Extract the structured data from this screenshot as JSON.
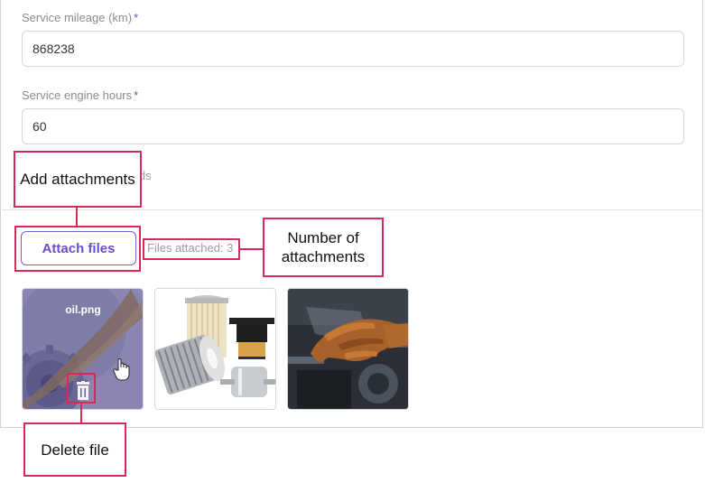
{
  "form": {
    "mileage_label": "Service mileage (km)",
    "required_mark": "*",
    "mileage_value": "868238",
    "engine_hours_label": "Service engine hours",
    "engine_hours_value": "60",
    "partially_hidden_text": "lds"
  },
  "attachments": {
    "attach_button_label": "Attach files",
    "files_attached_text": "Files attached: 3",
    "files": [
      {
        "name": "oil.png",
        "state": "hovered",
        "delete_icon": "trash-icon"
      },
      {
        "name": "",
        "state": "default"
      },
      {
        "name": "",
        "state": "default"
      }
    ]
  },
  "callouts": {
    "add_attachments": "Add attachments",
    "number_of_attachments": "Number of attachments",
    "delete_file": "Delete file"
  },
  "colors": {
    "accent": "#6c4fd1",
    "callout_border": "#d82a5a",
    "hover_overlay": "#5a4f8c"
  }
}
